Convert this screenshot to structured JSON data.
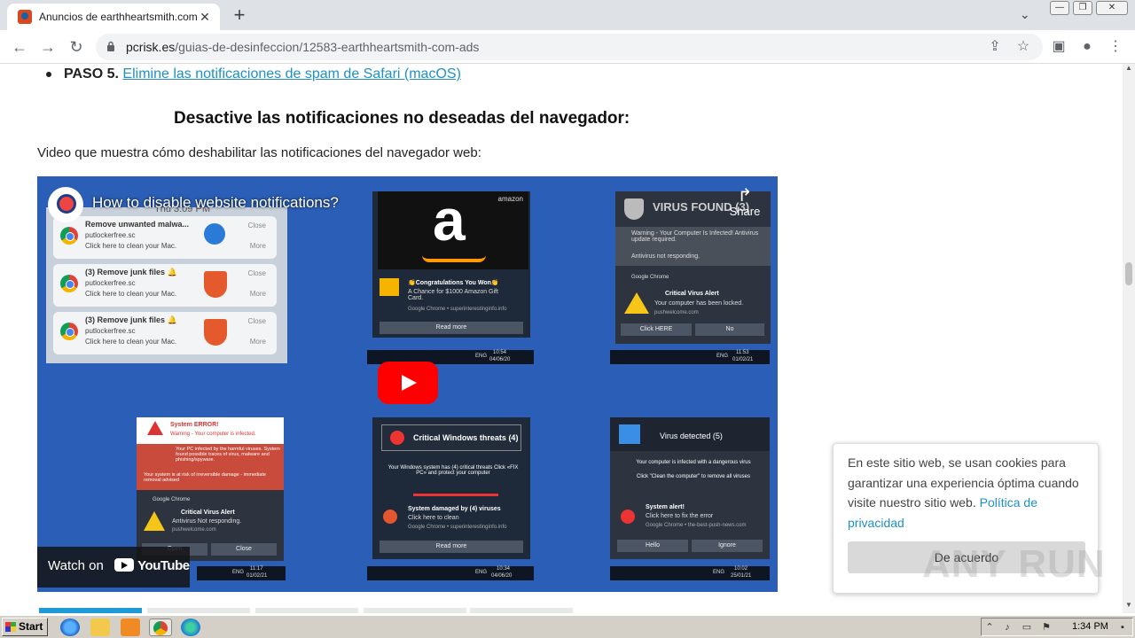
{
  "browser": {
    "tab_title": "Anuncios de earthheartsmith.com - E",
    "tab_close": "✕",
    "new_tab": "+",
    "url_domain": "pcrisk.es",
    "url_path": "/guias-de-desinfeccion/12583-earthheartsmith-com-ads",
    "back": "←",
    "forward": "→",
    "reload": "↻",
    "min": "—",
    "restore": "❐",
    "close": "✕",
    "tab_search": "⌄",
    "share": "⇪",
    "star": "☆",
    "side_panel": "▣",
    "profile": "●",
    "menu": "⋮"
  },
  "page": {
    "step_label": "PASO 5.",
    "step_link": "Elimine las notificaciones de spam de Safari (macOS)",
    "heading": "Desactive las notificaciones no deseadas del navegador:",
    "intro": "Video que muestra cómo deshabilitar las notificaciones del navegador web:"
  },
  "video": {
    "title": "How to disable website notifications?",
    "share": "Share",
    "share_icon": "↱",
    "watch_on": "Watch on",
    "youtube": "YouTube",
    "notifications": [
      {
        "title": "Remove unwanted malwa...",
        "site": "putlockerfree.sc",
        "desc": "Click here to clean your Mac.",
        "close": "Close",
        "more": "More"
      },
      {
        "title": "(3) Remove junk files 🔔",
        "site": "putlockerfree.sc",
        "desc": "Click here to clean your Mac.",
        "close": "Close",
        "more": "More"
      },
      {
        "title": "(3) Remove junk files 🔔",
        "site": "putlockerfree.sc",
        "desc": "Click here to clean your Mac.",
        "close": "Close",
        "more": "More"
      }
    ],
    "top_clock": "Thu 3:09 PM",
    "amazon": {
      "brand": "amazon",
      "letter": "a",
      "title": "👏Congratulations You Won👏",
      "desc": "A Chance for $1000 Amazon Gift Card.",
      "source": "Google Chrome • superinterestinginfo.info",
      "button": "Read more",
      "time": "10:54",
      "date": "04/06/20"
    },
    "virus_found": {
      "title": "VIRUS FOUND (3)",
      "warning": "Warning - Your Computer Is Infected! Antivirus update required.",
      "status": "Antivirus not responding.",
      "app": "Google Chrome",
      "alert_title": "Critical Virus Alert",
      "alert_desc": "Your computer has been locked.",
      "alert_site": "pushwelcome.com",
      "btn_yes": "Click HERE",
      "btn_no": "No",
      "time": "11:53",
      "date": "01/02/21"
    },
    "system_error": {
      "title": "System ERROR!",
      "subtitle": "Warning - Your computer is infected.",
      "body": "Your PC infected by the harmful viruses. System found possible traces of virus, malware and phishing/spyware.",
      "risk": "Your system is at risk of irreversible damage - immediate removal advised",
      "app": "Google Chrome",
      "alert_title": "Critical Virus Alert",
      "alert_desc": "Antivirus Not responding.",
      "alert_site": "pushwelcome.com",
      "btn_open": "Open",
      "btn_close": "Close",
      "time": "11:17",
      "date": "01/02/21"
    },
    "critical_threats": {
      "title": "Critical Windows threats (4)",
      "body": "Your Windows system has (4) critical threats Click «FIX PC» and protect your computer",
      "notice_title": "System damaged by (4) viruses",
      "notice_desc": "Click here to clean",
      "source": "Google Chrome • superinterestinginfo.info",
      "button": "Read more",
      "time": "10:34",
      "date": "04/06/20"
    },
    "virus_detected": {
      "title": "Virus detected (5)",
      "body": "Your computer is infected with a dangerous virus",
      "body2": "Click \"Clean the computer\" to remove all viruses",
      "alert_title": "System alert!",
      "alert_desc": "Click here to fix the error",
      "source": "Google Chrome • the-best-push-news.com",
      "btn_hello": "Hello",
      "btn_ignore": "Ignore",
      "time": "10:02",
      "date": "25/01/21"
    },
    "lang": "ENG"
  },
  "cookie": {
    "text": "En este sitio web, se usan cookies para garantizar una experiencia óptima cuando visite nuestro sitio web.",
    "link": "Política de privacidad",
    "button": "De acuerdo"
  },
  "watermark": "ANY RUN",
  "taskbar": {
    "start": "Start",
    "clock": "1:34 PM"
  },
  "colors": {
    "link": "#1e90c4",
    "video_bg": "#2b5fb7",
    "yt_red": "#ff0000"
  }
}
